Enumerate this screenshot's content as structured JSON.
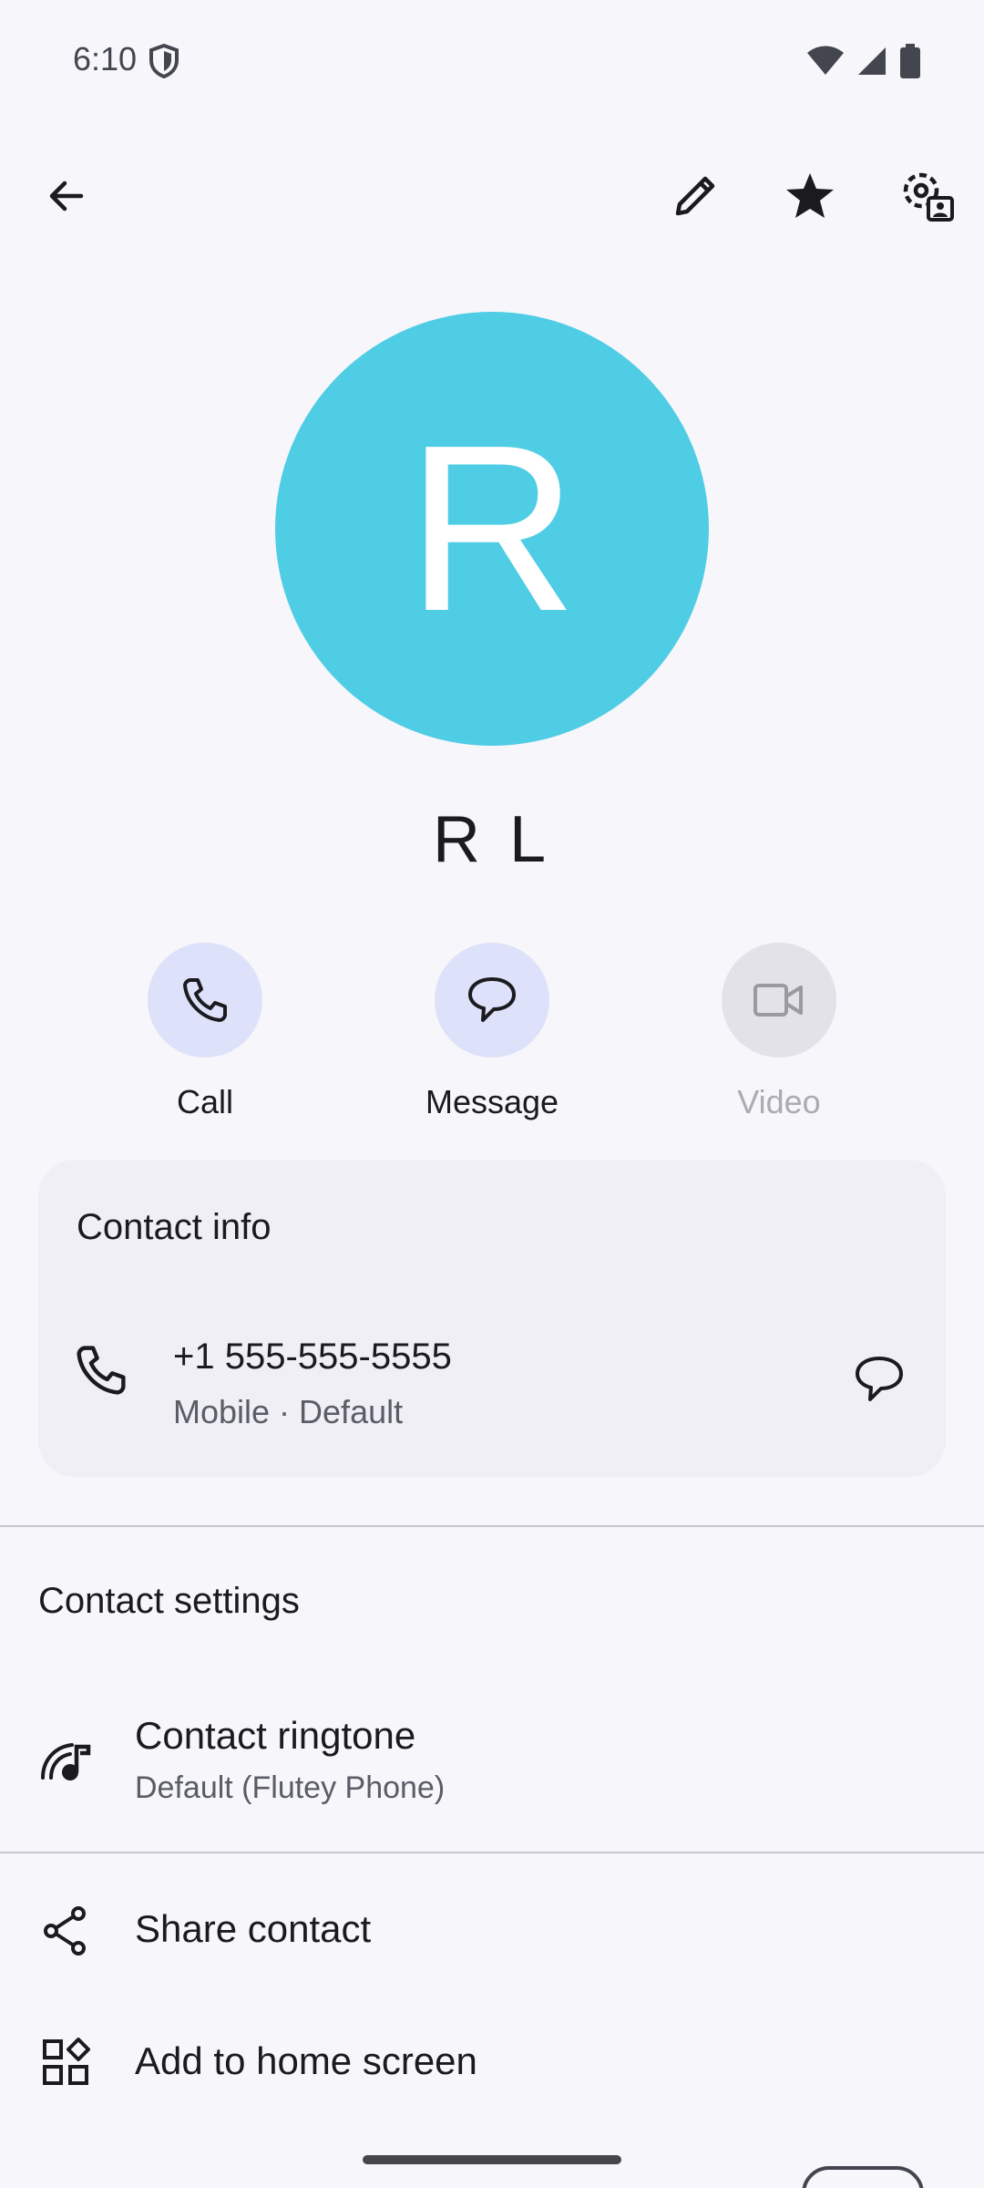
{
  "status": {
    "time": "6:10"
  },
  "contact": {
    "initial": "R",
    "name": "R L"
  },
  "actions": [
    {
      "label": "Call"
    },
    {
      "label": "Message"
    },
    {
      "label": "Video"
    }
  ],
  "contact_info": {
    "title": "Contact info",
    "phone": "+1 555-555-5555",
    "phone_detail": "Mobile · Default"
  },
  "contact_settings": {
    "title": "Contact settings",
    "ringtone_label": "Contact ringtone",
    "ringtone_value": "Default (Flutey Phone)"
  },
  "menu": {
    "share": "Share contact",
    "add_home": "Add to home screen"
  },
  "colors": {
    "avatar": "#4ECDE4",
    "action_bg": "#DDE1F9",
    "card_bg": "#EFEFF5",
    "background": "#F6F6FB"
  },
  "icons": [
    "back-arrow-icon",
    "edit-pencil-icon",
    "star-icon",
    "contact-settings-icon",
    "phone-icon",
    "message-bubble-icon",
    "video-camera-icon",
    "ringtone-icon",
    "share-icon",
    "widgets-icon"
  ]
}
